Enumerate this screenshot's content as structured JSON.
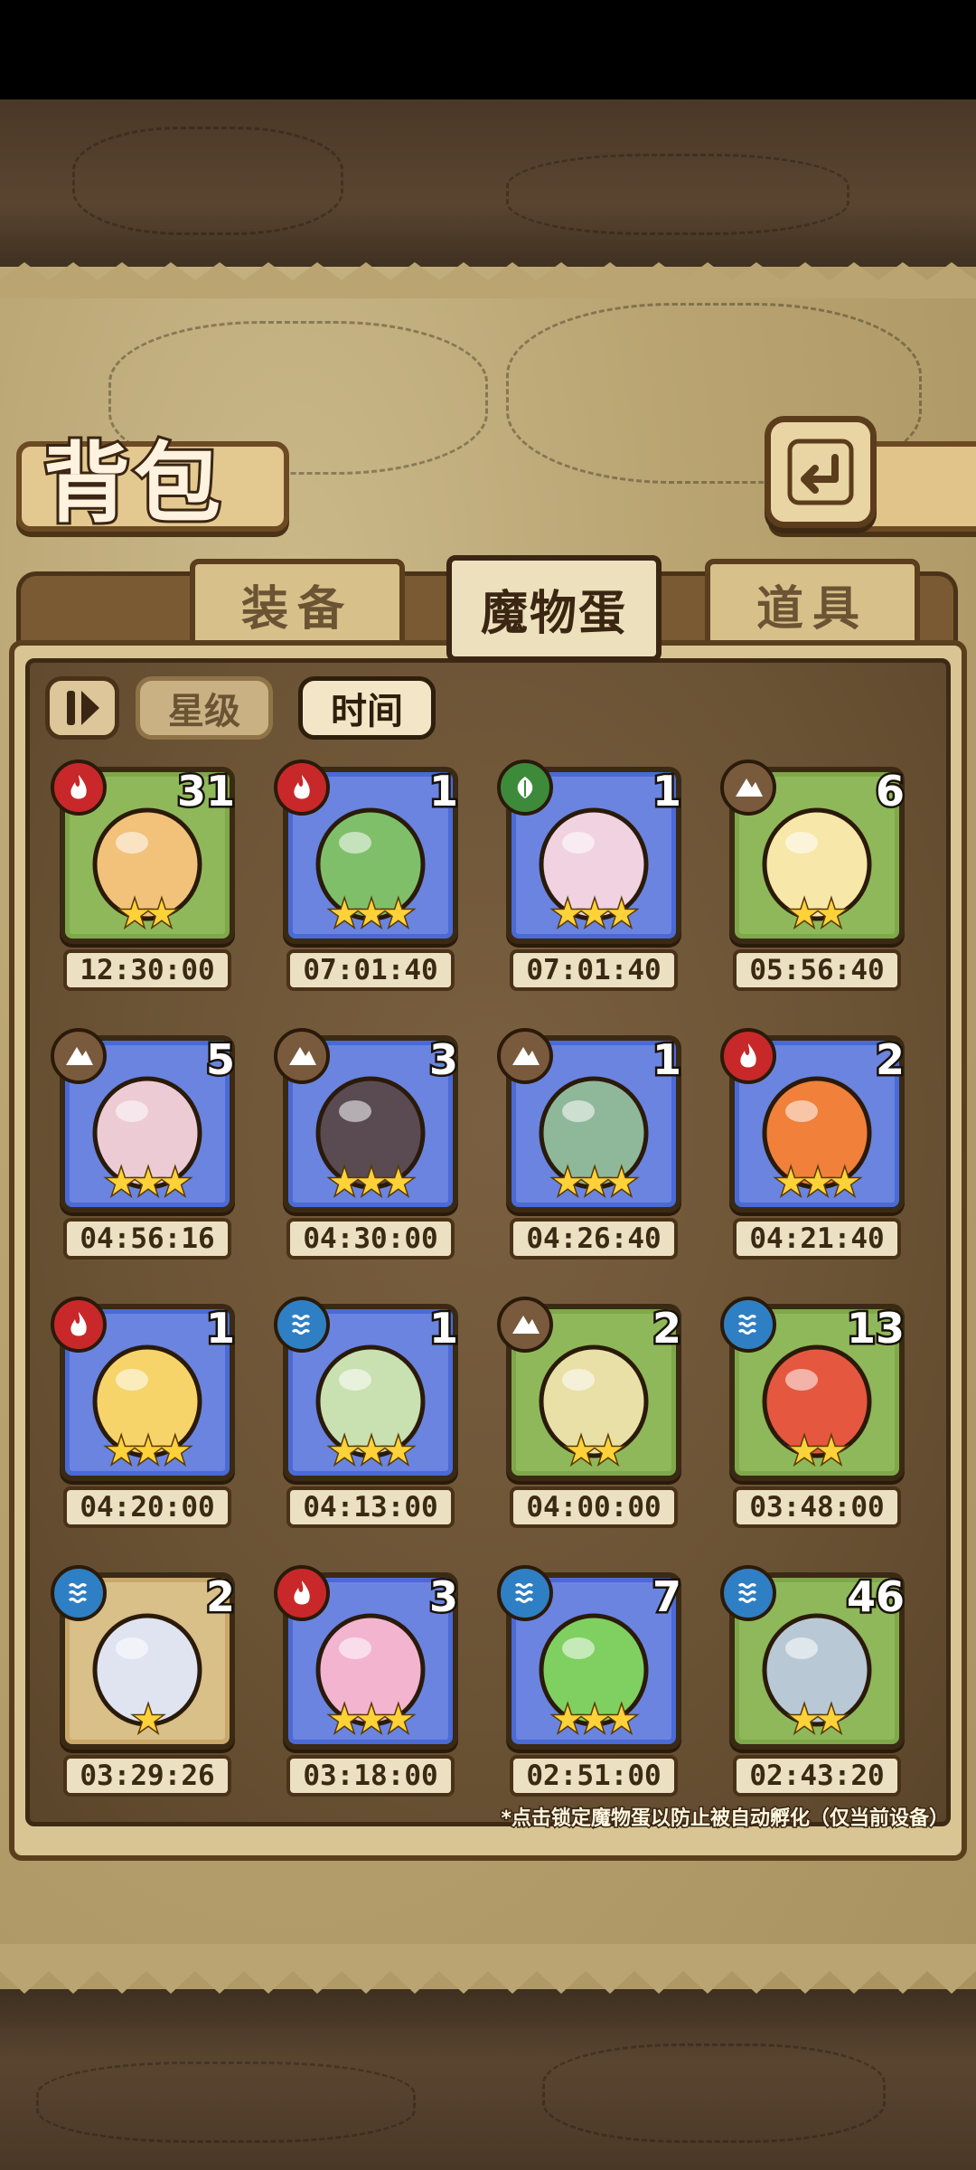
{
  "header": {
    "title": "背包"
  },
  "tabs": [
    {
      "label": "装备",
      "active": false
    },
    {
      "label": "魔物蛋",
      "active": true
    },
    {
      "label": "道具",
      "active": false
    }
  ],
  "sort": {
    "star_label": "星级",
    "time_label": "时间"
  },
  "eggs": [
    {
      "element": "fire",
      "count": "31",
      "stars": "★★",
      "time": "12:30:00",
      "frame": "green",
      "color": "#f2c27a"
    },
    {
      "element": "fire",
      "count": "1",
      "stars": "★★★",
      "time": "07:01:40",
      "frame": "blue",
      "color": "#7fbf6a"
    },
    {
      "element": "leaf",
      "count": "1",
      "stars": "★★★",
      "time": "07:01:40",
      "frame": "blue",
      "color": "#f0d2e0"
    },
    {
      "element": "earth",
      "count": "6",
      "stars": "★★",
      "time": "05:56:40",
      "frame": "green",
      "color": "#f7e7a8"
    },
    {
      "element": "earth",
      "count": "5",
      "stars": "★★★",
      "time": "04:56:16",
      "frame": "blue",
      "color": "#eccbd4"
    },
    {
      "element": "earth",
      "count": "3",
      "stars": "★★★",
      "time": "04:30:00",
      "frame": "blue",
      "color": "#5a4a52"
    },
    {
      "element": "earth",
      "count": "1",
      "stars": "★★★",
      "time": "04:26:40",
      "frame": "blue",
      "color": "#8fb89a"
    },
    {
      "element": "fire",
      "count": "2",
      "stars": "★★★",
      "time": "04:21:40",
      "frame": "blue",
      "color": "#f0803a"
    },
    {
      "element": "fire",
      "count": "1",
      "stars": "★★★",
      "time": "04:20:00",
      "frame": "blue",
      "color": "#f6d46a"
    },
    {
      "element": "water",
      "count": "1",
      "stars": "★★★",
      "time": "04:13:00",
      "frame": "blue",
      "color": "#c9e0b0"
    },
    {
      "element": "earth",
      "count": "2",
      "stars": "★★",
      "time": "04:00:00",
      "frame": "green",
      "color": "#e9e0a8"
    },
    {
      "element": "water",
      "count": "13",
      "stars": "★★",
      "time": "03:48:00",
      "frame": "green",
      "color": "#e5573f"
    },
    {
      "element": "water",
      "count": "2",
      "stars": "★",
      "time": "03:29:26",
      "frame": "tan",
      "color": "#dfe4f0"
    },
    {
      "element": "fire",
      "count": "3",
      "stars": "★★★",
      "time": "03:18:00",
      "frame": "blue",
      "color": "#f3b4d0"
    },
    {
      "element": "water",
      "count": "7",
      "stars": "★★★",
      "time": "02:51:00",
      "frame": "blue",
      "color": "#7fd060"
    },
    {
      "element": "water",
      "count": "46",
      "stars": "★★",
      "time": "02:43:20",
      "frame": "green",
      "color": "#b8c8d4"
    }
  ],
  "footnote": "*点击锁定魔物蛋以防止被自动孵化（仅当前设备）",
  "colors": {
    "fire": "#c8282a",
    "leaf": "#3d8a3a",
    "earth": "#7a5a3c",
    "water": "#2f7fc4",
    "frame_green": "#7fa84a",
    "frame_blue": "#4a6ad6",
    "frame_tan": "#c9a86a"
  }
}
